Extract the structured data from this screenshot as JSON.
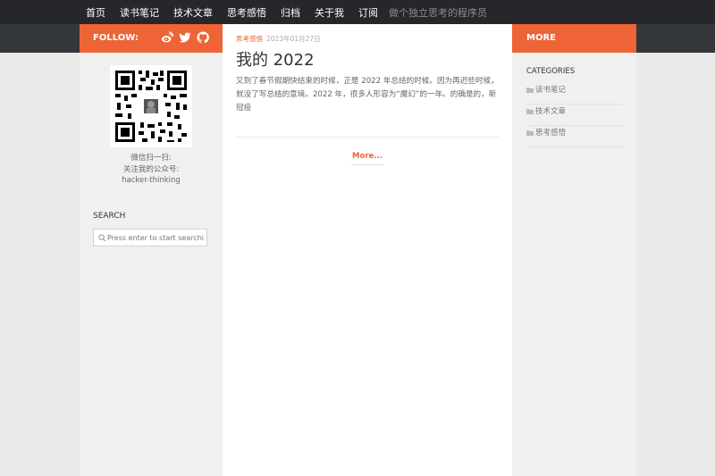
{
  "nav": {
    "items": [
      {
        "label": "首页"
      },
      {
        "label": "读书笔记"
      },
      {
        "label": "技术文章"
      },
      {
        "label": "思考感悟"
      },
      {
        "label": "归档"
      },
      {
        "label": "关于我"
      },
      {
        "label": "订阅"
      }
    ],
    "tagline": "做个独立思考的程序员"
  },
  "sidebar_left": {
    "follow_label": "FOLLOW:",
    "social_icons": [
      "weibo-icon",
      "twitter-icon",
      "github-icon"
    ],
    "qr_caption": [
      "微信扫一扫:",
      "关注我的公众号:",
      "hacker-thinking"
    ],
    "search_title": "SEARCH",
    "search_placeholder": "Press enter to start searching"
  },
  "post": {
    "category": "思考感悟",
    "date": "2023年01月27日",
    "title": "我的 2022",
    "excerpt": "又到了春节假期快结束的时候，正是 2022 年总结的时候。因为再迟些时候，就没了写总结的意境。2022 年，很多人形容为“魔幻”的一年。的确是的，新冠疫",
    "more_label": "More..."
  },
  "sidebar_right": {
    "more_label": "MORE",
    "categories_title": "CATEGORIES",
    "categories": [
      {
        "label": "读书笔记"
      },
      {
        "label": "技术文章"
      },
      {
        "label": "思考感悟"
      }
    ]
  },
  "colors": {
    "accent": "#ee6436",
    "nav_bg": "#26272b",
    "sidebar_bg": "#f0f0f0"
  }
}
